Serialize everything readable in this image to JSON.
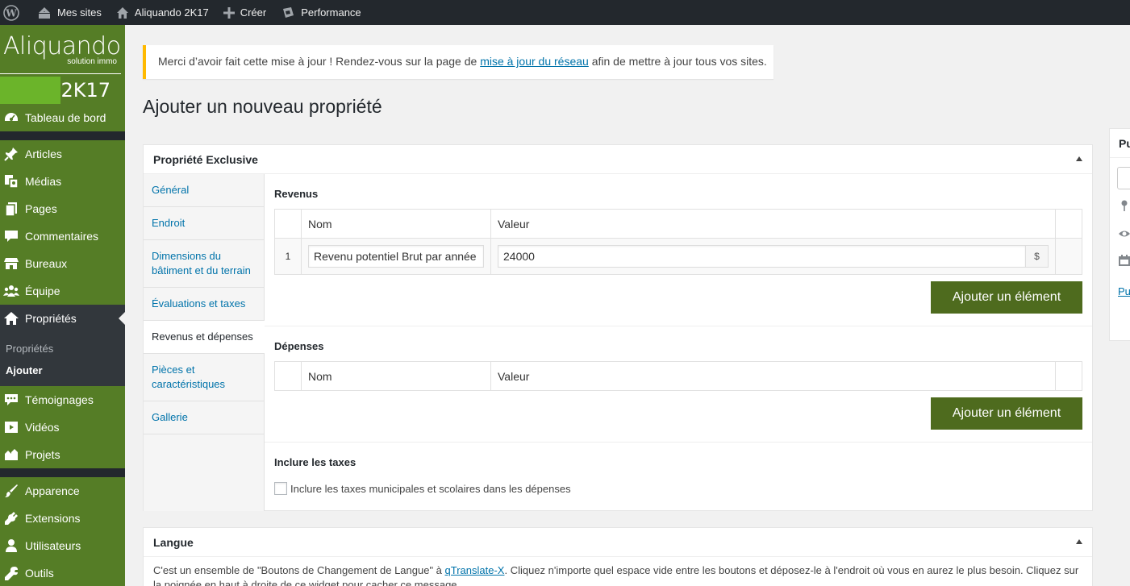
{
  "adminbar": {
    "my_sites": "Mes sites",
    "site_name": "Aliquando 2K17",
    "new": "Créer",
    "performance": "Performance"
  },
  "logo": {
    "brand": "Aliquando",
    "tagline": "solution immo",
    "year": "2K17"
  },
  "sidebar": {
    "dashboard": "Tableau de bord",
    "items_a": [
      "Articles",
      "Médias",
      "Pages",
      "Commentaires",
      "Bureaux",
      "Équipe"
    ],
    "active": "Propriétés",
    "submenu": [
      "Propriétés",
      "Ajouter"
    ],
    "items_b": [
      "Témoignages",
      "Vidéos",
      "Projets"
    ],
    "items_c": [
      "Apparence",
      "Extensions",
      "Utilisateurs",
      "Outils"
    ]
  },
  "notice": {
    "before": "Merci d’avoir fait cette mise à jour ! Rendez-vous sur la page de ",
    "link": "mise à jour du réseau",
    "after": " afin de mettre à jour tous vos sites."
  },
  "page_title": "Ajouter un nouveau propriété",
  "metabox": {
    "title": "Propriété Exclusive",
    "tabs": [
      "Général",
      "Endroit",
      "Dimensions du bâtiment et du terrain",
      "Évaluations et taxes",
      "Revenus et dépenses",
      "Pièces et caractéristiques",
      "Gallerie"
    ],
    "revenus": {
      "label": "Revenus",
      "col_name": "Nom",
      "col_value": "Valeur",
      "row_index": "1",
      "row_name": "Revenu potentiel Brut par année",
      "row_value": "24000",
      "currency": "$",
      "add_button": "Ajouter un élément"
    },
    "depenses": {
      "label": "Dépenses",
      "col_name": "Nom",
      "col_value": "Valeur",
      "add_button": "Ajouter un élément"
    },
    "taxes": {
      "label": "Inclure les taxes",
      "checkbox_label": "Inclure les taxes municipales et scolaires dans les dépenses"
    }
  },
  "langue": {
    "title": "Langue",
    "text_before": "C'est un ensemble de \"Boutons de Changement de Langue\" à ",
    "link": "qTranslate-X",
    "text_after": ". Cliquez n'importe quel espace vide entre les boutons et déposez-le à l'endroit où vous en aurez le plus besoin. Cliquez sur la poignée en haut à droite de ce widget pour cacher ce message."
  },
  "publish_box": {
    "title": "Pu",
    "link": "Pu"
  },
  "colors": {
    "sidebar": "#557d26",
    "button": "#4e6b1e",
    "accent_green": "#6bb42a",
    "notice_border": "#ffb900"
  }
}
